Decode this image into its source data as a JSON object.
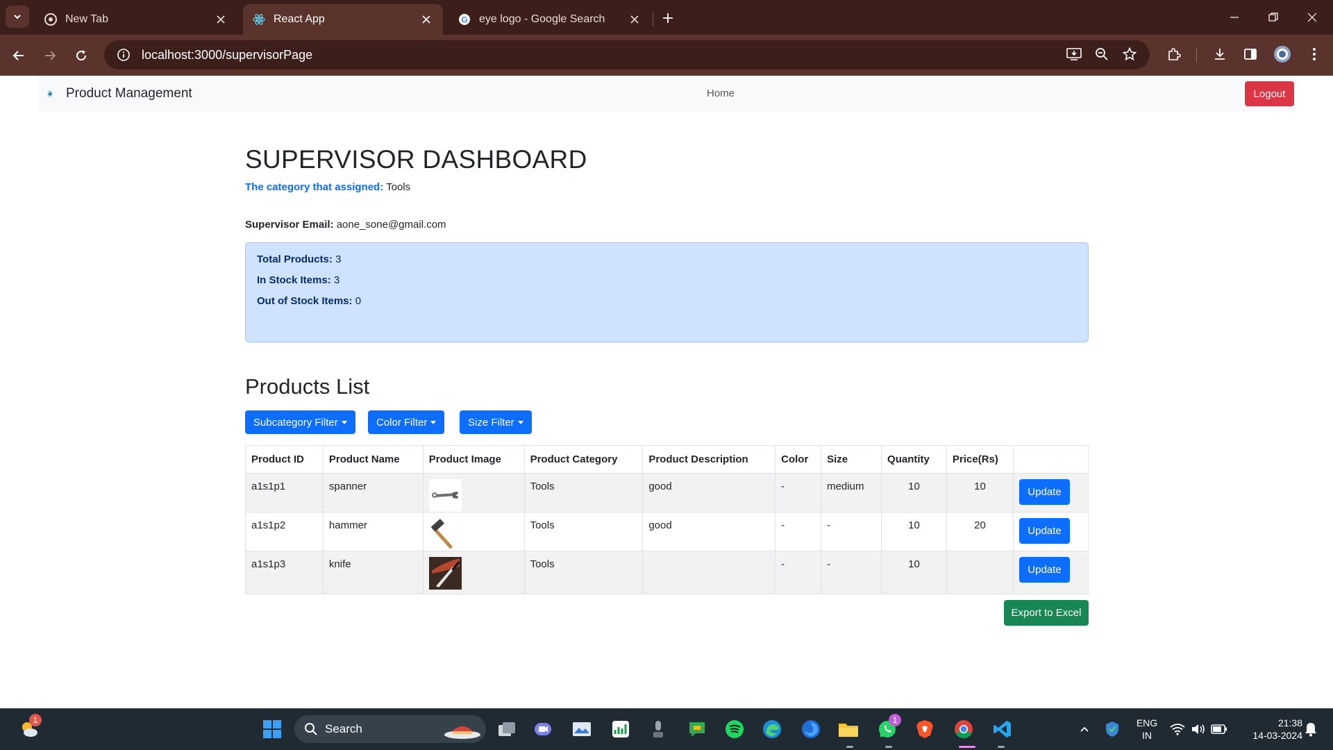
{
  "browser": {
    "tabs": [
      {
        "title": "New Tab",
        "icon": "chrome-icon"
      },
      {
        "title": "React App",
        "icon": "react-icon",
        "active": true
      },
      {
        "title": "eye logo - Google Search",
        "icon": "google-icon"
      }
    ],
    "url": "localhost:3000/supervisorPage"
  },
  "navbar": {
    "brand": "Product Management",
    "home": "Home",
    "logout": "Logout"
  },
  "dashboard": {
    "title": "SUPERVISOR DASHBOARD",
    "category_label": "The category that assigned:",
    "category_value": "Tools",
    "email_label": "Supervisor Email:",
    "email_value": "aone_sone@gmail.com",
    "stats": {
      "total_label": "Total Products:",
      "total_value": "3",
      "instock_label": "In Stock Items:",
      "instock_value": "3",
      "outstock_label": "Out of Stock Items:",
      "outstock_value": "0"
    }
  },
  "products": {
    "heading": "Products List",
    "filters": [
      "Subcategory Filter",
      "Color Filter",
      "Size Filter"
    ],
    "columns": [
      "Product ID",
      "Product Name",
      "Product Image",
      "Product Category",
      "Product Description",
      "Color",
      "Size",
      "Quantity",
      "Price(Rs)",
      ""
    ],
    "rows": [
      {
        "id": "a1s1p1",
        "name": "spanner",
        "image": "spanner-image",
        "category": "Tools",
        "description": "good",
        "color": "-",
        "size": "medium",
        "quantity": "10",
        "price": "10",
        "action": "Update"
      },
      {
        "id": "a1s1p2",
        "name": "hammer",
        "image": "hammer-image",
        "category": "Tools",
        "description": "good",
        "color": "-",
        "size": "-",
        "quantity": "10",
        "price": "20",
        "action": "Update"
      },
      {
        "id": "a1s1p3",
        "name": "knife",
        "image": "knife-image",
        "category": "Tools",
        "description": "",
        "color": "-",
        "size": "-",
        "quantity": "10",
        "price": "",
        "action": "Update"
      }
    ],
    "export": "Export to Excel"
  },
  "taskbar": {
    "search": "Search",
    "lang_top": "ENG",
    "lang_bottom": "IN",
    "time": "21:38",
    "date": "14-03-2024",
    "weather_badge": "1",
    "whatsapp_badge": "1"
  },
  "colors": {
    "primary": "#0d6efd",
    "danger": "#dc3545",
    "success": "#198754",
    "alert_bg": "#cfe2ff",
    "chrome_dark": "#3c1f1a",
    "chrome_toolbar": "#5a332c"
  }
}
